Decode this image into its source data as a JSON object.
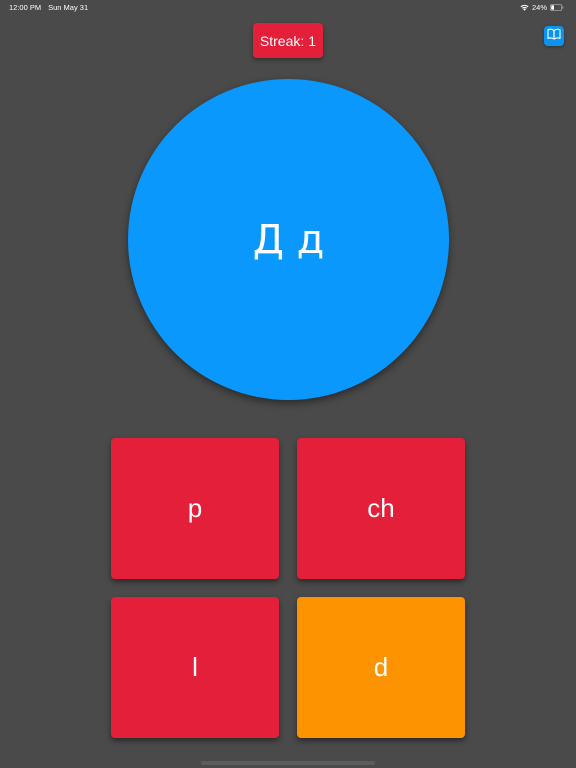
{
  "status_bar": {
    "time": "12:00 PM",
    "date": "Sun May 31",
    "battery": "24%"
  },
  "streak": {
    "label": "Streak:",
    "value": "1"
  },
  "letter": "Д д",
  "answers": [
    {
      "label": "p",
      "color": "#e41f3a"
    },
    {
      "label": "ch",
      "color": "#e41f3a"
    },
    {
      "label": "l",
      "color": "#e41f3a"
    },
    {
      "label": "d",
      "color": "#fd9300"
    }
  ],
  "icons": {
    "book_button": "book-icon",
    "wifi": "wifi-icon",
    "battery": "battery-icon"
  },
  "colors": {
    "background": "#4a4a4a",
    "accent_red": "#e41f3a",
    "accent_blue": "#0a98fc",
    "accent_orange": "#fd9300"
  }
}
